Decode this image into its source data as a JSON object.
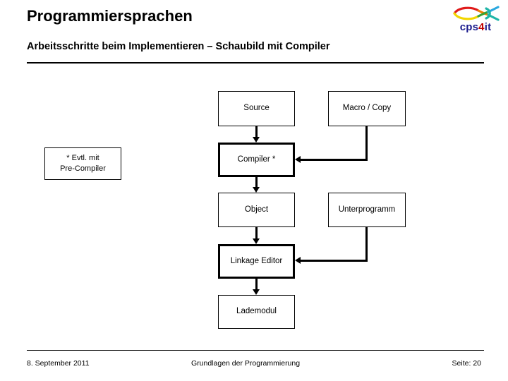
{
  "header": {
    "title": "Programmiersprachen",
    "subtitle": "Arbeitsschritte beim Implementieren – Schaubild mit Compiler"
  },
  "logo": {
    "name": "cps4it-fish-logo",
    "wordmark_prefix": "cps",
    "wordmark_accent": "4",
    "wordmark_suffix": "it",
    "colors": {
      "red": "#e01b1b",
      "orange": "#f08000",
      "yellow": "#f2d600",
      "green": "#36a336",
      "teal": "#1fb5a8",
      "cyan": "#29a8df",
      "wordmark": "#1a1a8c",
      "wordmark_accent": "#c00000"
    }
  },
  "diagram": {
    "type": "flowchart",
    "nodes": [
      {
        "id": "source",
        "label": "Source",
        "emphasis": false
      },
      {
        "id": "macro_copy",
        "label": "Macro / Copy",
        "emphasis": false
      },
      {
        "id": "compiler",
        "label": "Compiler *",
        "emphasis": true
      },
      {
        "id": "object",
        "label": "Object",
        "emphasis": false
      },
      {
        "id": "unterprogramm",
        "label": "Unterprogramm",
        "emphasis": false
      },
      {
        "id": "linkage_editor",
        "label": "Linkage Editor",
        "emphasis": true
      },
      {
        "id": "lademodul",
        "label": "Lademodul",
        "emphasis": false
      }
    ],
    "note": {
      "id": "precompiler_note",
      "line1": "* Evtl. mit",
      "line2": "Pre-Compiler"
    },
    "edges": [
      {
        "from": "source",
        "to": "compiler",
        "style": "straight-down"
      },
      {
        "from": "macro_copy",
        "to": "compiler",
        "style": "down-then-left"
      },
      {
        "from": "compiler",
        "to": "object",
        "style": "straight-down"
      },
      {
        "from": "object",
        "to": "linkage_editor",
        "style": "straight-down"
      },
      {
        "from": "unterprogramm",
        "to": "linkage_editor",
        "style": "down-then-left"
      },
      {
        "from": "linkage_editor",
        "to": "lademodul",
        "style": "straight-down"
      }
    ]
  },
  "footer": {
    "date": "8. September 2011",
    "center": "Grundlagen der Programmierung",
    "page": "Seite: 20"
  }
}
